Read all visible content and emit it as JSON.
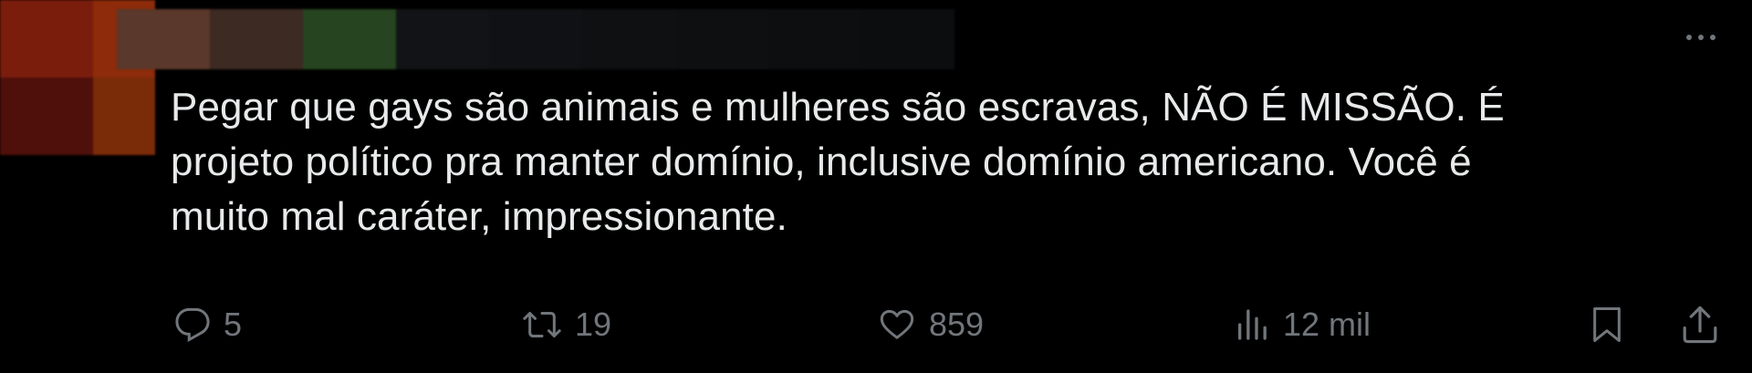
{
  "tweet": {
    "text": "Pegar que gays são animais e mulheres são escravas, NÃO É MISSÃO. É\nprojeto político pra manter domínio, inclusive domínio americano. Você é\nmuito mal caráter, impressionante.",
    "avatar_censored_colors": [
      "#7a1d0c",
      "#8d2b0a",
      "#4f0f0a",
      "#7a2c08"
    ],
    "name_censored_colors": [
      "#5a382b",
      "#3d2a22",
      "#25441f",
      "#121316",
      "#101114",
      "#0f1012",
      "#0e0f11",
      "#0d0e10",
      "#0c0d0f"
    ]
  },
  "actions": {
    "reply": {
      "icon": "reply-icon",
      "count": "5"
    },
    "retweet": {
      "icon": "retweet-icon",
      "count": "19"
    },
    "like": {
      "icon": "heart-icon",
      "count": "859"
    },
    "views": {
      "icon": "views-icon",
      "count": "12 mil"
    },
    "bookmark": {
      "icon": "bookmark-icon"
    },
    "share": {
      "icon": "share-icon"
    }
  },
  "colors": {
    "background": "#000000",
    "text": "#e7e9ea",
    "muted": "#71767b"
  }
}
